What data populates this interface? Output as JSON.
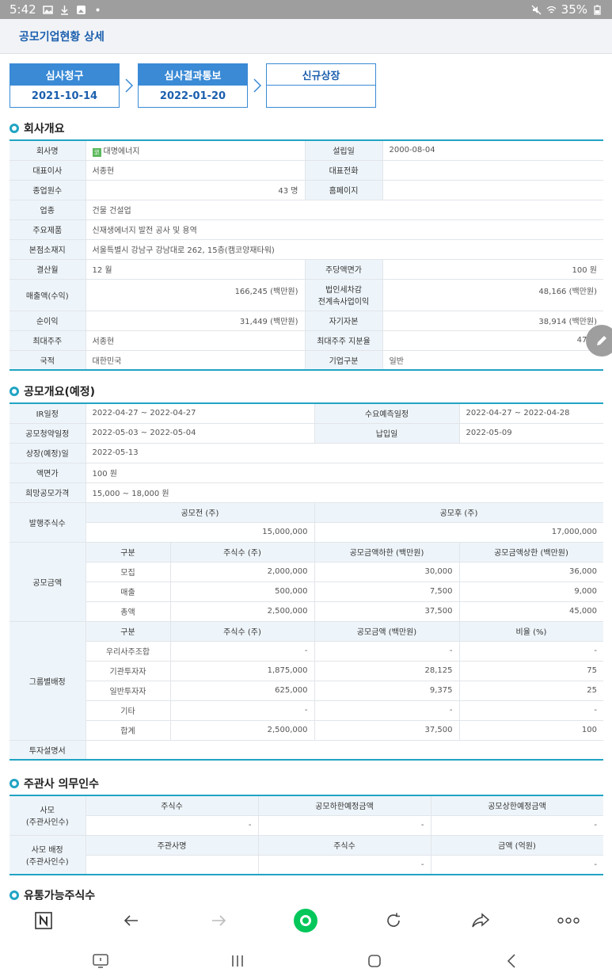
{
  "status_bar": {
    "time": "5:42",
    "battery": "35%"
  },
  "app_bar": {
    "title": "공모기업현황 상세"
  },
  "steps": [
    {
      "label": "심사청구",
      "value": "2021-10-14"
    },
    {
      "label": "심사결과통보",
      "value": "2022-01-20"
    },
    {
      "label": "신규상장",
      "value": ""
    }
  ],
  "company": {
    "section_title": "회사개요",
    "name_label": "회사명",
    "name_badge": "코",
    "name": "대명에너지",
    "founded_label": "설립일",
    "founded": "2000-08-04",
    "ceo_label": "대표이사",
    "ceo": "서종현",
    "phone_label": "대표전화",
    "phone": "",
    "employees_label": "종업원수",
    "employees": "43 명",
    "homepage_label": "홈페이지",
    "homepage": "",
    "industry_label": "업종",
    "industry": "건물 건설업",
    "products_label": "주요제품",
    "products": "신재생에너지 발전 공사 및 용역",
    "hq_label": "본점소재지",
    "hq": "서울특별시 강남구 강남대로 262, 15층(캠코양재타워)",
    "fiscal_label": "결산월",
    "fiscal": "12 월",
    "par_label": "주당액면가",
    "par": "100 원",
    "revenue_label": "매출액(수익)",
    "revenue": "166,245 (백만원)",
    "pretax_label_1": "법인세차감",
    "pretax_label_2": "전계속사업이익",
    "pretax": "48,166 (백만원)",
    "net_label": "순이익",
    "net": "31,449 (백만원)",
    "equity_label": "자기자본",
    "equity": "38,914 (백만원)",
    "major_label": "최대주주",
    "major": "서종현",
    "major_ratio_label": "최대주주 지분율",
    "major_ratio": "47 %",
    "nation_label": "국적",
    "nation": "대한민국",
    "category_label": "기업구분",
    "category": "일반"
  },
  "ipo": {
    "section_title": "공모개요(예정)",
    "ir_label": "IR일정",
    "ir": "2022-04-27 ~ 2022-04-27",
    "demand_label": "수요예측일정",
    "demand": "2022-04-27 ~ 2022-04-28",
    "sub_label": "공모청약일정",
    "sub": "2022-05-03 ~ 2022-05-04",
    "pay_label": "납입일",
    "pay": "2022-05-09",
    "listing_label": "상장(예정)일",
    "listing": "2022-05-13",
    "par_label": "액면가",
    "par": "100 원",
    "price_label": "희망공모가격",
    "price": "15,000 ~ 18,000 원",
    "shares_label": "발행주식수",
    "before_label": "공모전 (주)",
    "before": "15,000,000",
    "after_label": "공모후 (주)",
    "after": "17,000,000",
    "amount_label": "공모금액",
    "amount_headers": [
      "구분",
      "주식수 (주)",
      "공모금액하한 (백만원)",
      "공모금액상한 (백만원)"
    ],
    "amount_rows": [
      [
        "모집",
        "2,000,000",
        "30,000",
        "36,000"
      ],
      [
        "매출",
        "500,000",
        "7,500",
        "9,000"
      ],
      [
        "총액",
        "2,500,000",
        "37,500",
        "45,000"
      ]
    ],
    "group_label": "그룹별배정",
    "group_headers": [
      "구분",
      "주식수 (주)",
      "공모금액 (백만원)",
      "비율 (%)"
    ],
    "group_rows": [
      [
        "우리사주조합",
        "-",
        "-",
        "-"
      ],
      [
        "기관투자자",
        "1,875,000",
        "28,125",
        "75"
      ],
      [
        "일반투자자",
        "625,000",
        "9,375",
        "25"
      ],
      [
        "기타",
        "-",
        "-",
        "-"
      ],
      [
        "합계",
        "2,500,000",
        "37,500",
        "100"
      ]
    ],
    "prospectus_label": "투자설명서"
  },
  "underwriter": {
    "section_title": "주관사 의무인수",
    "row1_label_1": "사모",
    "row1_label_2": "(주관사인수)",
    "row1_headers": [
      "주식수",
      "공모하한예정금액",
      "공모상한예정금액"
    ],
    "row1_values": [
      "-",
      "-",
      "-"
    ],
    "row2_label_1": "사모 배정",
    "row2_label_2": "(주관사인수)",
    "row2_headers": [
      "주관사명",
      "주식수",
      "금액 (억원)"
    ],
    "row2_values": [
      "",
      "-",
      "-"
    ]
  },
  "float": {
    "section_title": "유통가능주식수"
  }
}
